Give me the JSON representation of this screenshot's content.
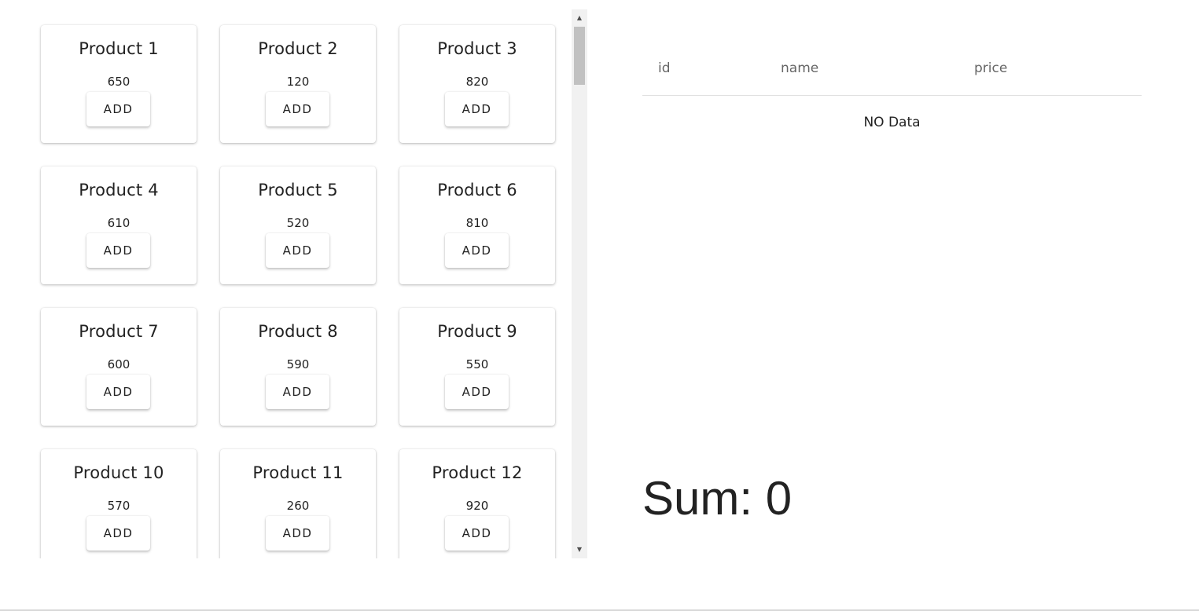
{
  "products": [
    {
      "name": "Product 1",
      "price": "650",
      "button": "ADD"
    },
    {
      "name": "Product 2",
      "price": "120",
      "button": "ADD"
    },
    {
      "name": "Product 3",
      "price": "820",
      "button": "ADD"
    },
    {
      "name": "Product 4",
      "price": "610",
      "button": "ADD"
    },
    {
      "name": "Product 5",
      "price": "520",
      "button": "ADD"
    },
    {
      "name": "Product 6",
      "price": "810",
      "button": "ADD"
    },
    {
      "name": "Product 7",
      "price": "600",
      "button": "ADD"
    },
    {
      "name": "Product 8",
      "price": "590",
      "button": "ADD"
    },
    {
      "name": "Product 9",
      "price": "550",
      "button": "ADD"
    },
    {
      "name": "Product 10",
      "price": "570",
      "button": "ADD"
    },
    {
      "name": "Product 11",
      "price": "260",
      "button": "ADD"
    },
    {
      "name": "Product 12",
      "price": "920",
      "button": "ADD"
    }
  ],
  "scrollbar": {
    "up_icon": "▲",
    "down_icon": "▼"
  },
  "cart": {
    "columns": {
      "id": "id",
      "name": "name",
      "price": "price"
    },
    "empty_message": "NO Data"
  },
  "sum": {
    "label": "Sum: 0"
  }
}
